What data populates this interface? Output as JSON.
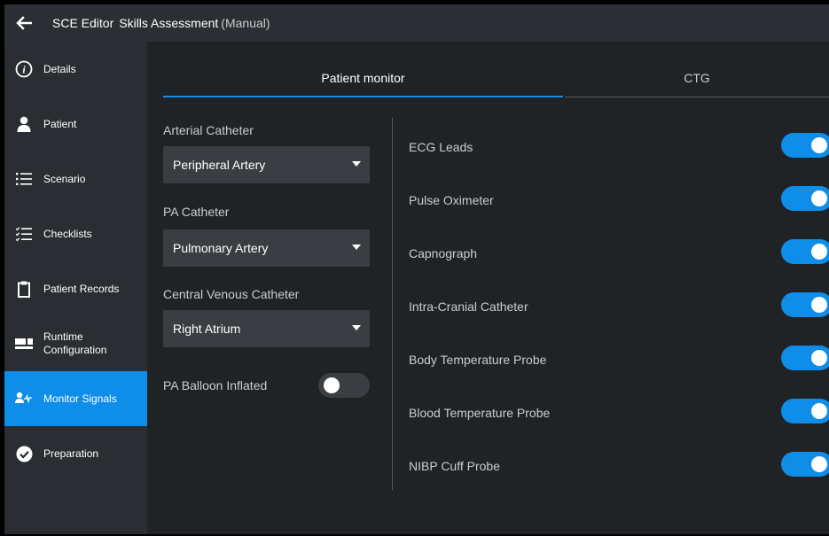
{
  "header": {
    "title": "SCE Editor",
    "subtitle": "Skills Assessment",
    "mode": "(Manual)"
  },
  "sidebar": {
    "items": [
      {
        "label": "Details",
        "icon": "info-icon"
      },
      {
        "label": "Patient",
        "icon": "person-icon"
      },
      {
        "label": "Scenario",
        "icon": "list-icon"
      },
      {
        "label": "Checklists",
        "icon": "checklist-icon"
      },
      {
        "label": "Patient Records",
        "icon": "clipboard-icon"
      },
      {
        "label": "Runtime Configuration",
        "icon": "layout-icon"
      },
      {
        "label": "Monitor Signals",
        "icon": "person-signal-icon",
        "active": true
      },
      {
        "label": "Preparation",
        "icon": "check-circle-icon"
      }
    ]
  },
  "tabs": [
    {
      "label": "Patient monitor",
      "active": true
    },
    {
      "label": "CTG",
      "active": false
    }
  ],
  "left_panel": {
    "arterial_catheter": {
      "label": "Arterial Catheter",
      "value": "Peripheral Artery"
    },
    "pa_catheter": {
      "label": "PA Catheter",
      "value": "Pulmonary Artery"
    },
    "central_venous_catheter": {
      "label": "Central Venous Catheter",
      "value": "Right Atrium"
    },
    "pa_balloon": {
      "label": "PA Balloon Inflated",
      "on": false
    }
  },
  "signals": [
    {
      "label": "ECG Leads",
      "on": true
    },
    {
      "label": "Pulse Oximeter",
      "on": true
    },
    {
      "label": "Capnograph",
      "on": true
    },
    {
      "label": "Intra-Cranial Catheter",
      "on": true
    },
    {
      "label": "Body Temperature Probe",
      "on": true
    },
    {
      "label": "Blood Temperature Probe",
      "on": true
    },
    {
      "label": "NIBP Cuff Probe",
      "on": true
    }
  ],
  "colors": {
    "accent": "#0e8de9",
    "background": "#202326",
    "sidebar": "#2a2d31",
    "topbar": "#2b2f33"
  }
}
